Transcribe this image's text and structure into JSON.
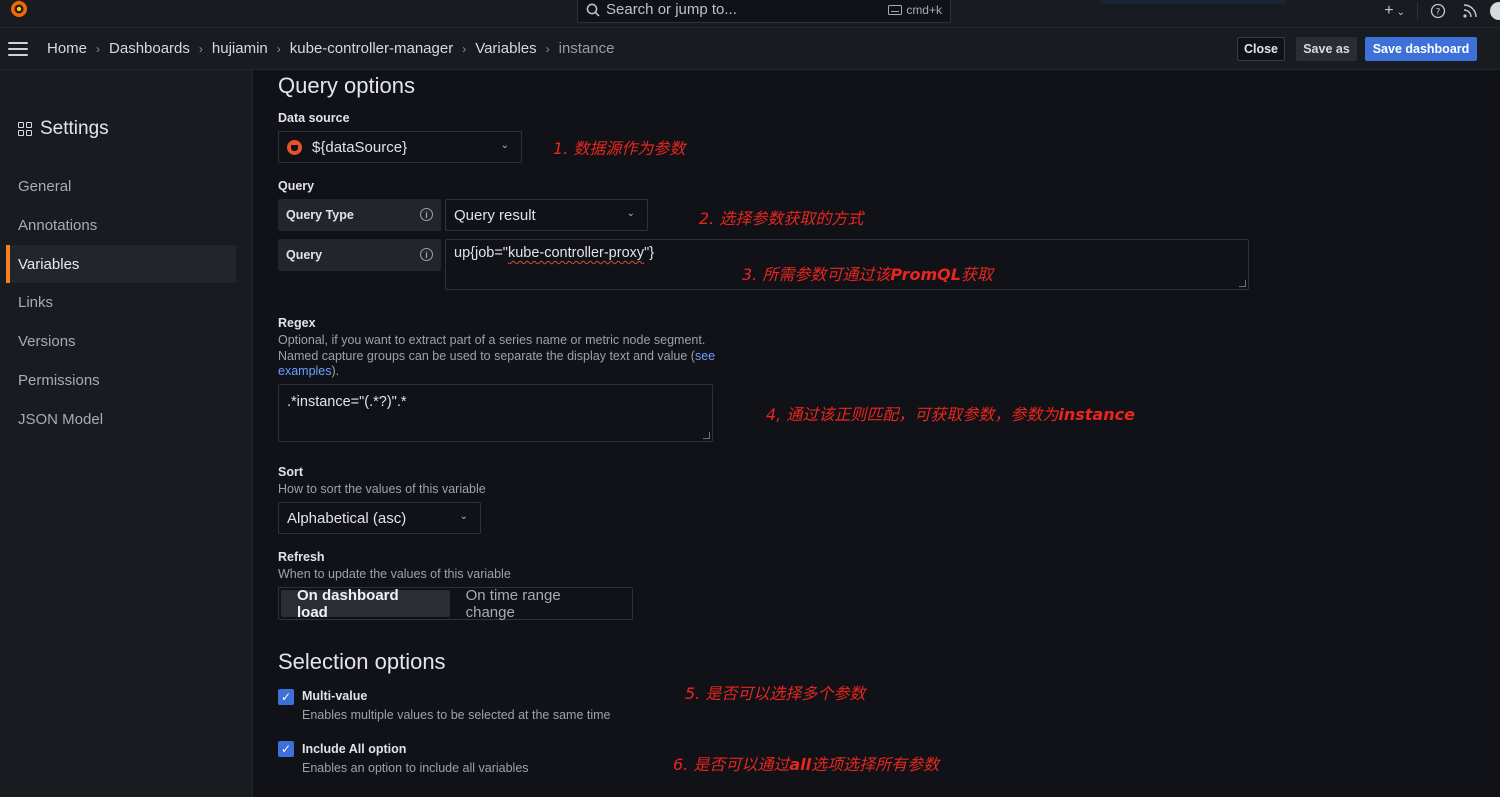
{
  "topbar": {
    "search_placeholder": "Search or jump to...",
    "shortcut": "cmd+k",
    "icons": [
      "grafana-logo-icon",
      "search-icon",
      "keyboard-icon",
      "plus-icon",
      "chevron-down-icon",
      "help-icon",
      "rss-icon",
      "avatar"
    ]
  },
  "breadcrumb": {
    "items": [
      "Home",
      "Dashboards",
      "hujiamin",
      "kube-controller-manager",
      "Variables",
      "instance"
    ]
  },
  "actions": {
    "close": "Close",
    "save_as": "Save as",
    "save_dashboard": "Save dashboard"
  },
  "sidebar": {
    "title": "Settings",
    "items": [
      "General",
      "Annotations",
      "Variables",
      "Links",
      "Versions",
      "Permissions",
      "JSON Model"
    ],
    "active": "Variables"
  },
  "query_options": {
    "heading": "Query options",
    "data_source_label": "Data source",
    "data_source_value": "${dataSource}",
    "query_label": "Query",
    "query_type_label": "Query Type",
    "query_type_value": "Query result",
    "query_field_label": "Query",
    "query_value_prefix": "up{job=\"",
    "query_value_mid": "kube-controller-proxy",
    "query_value_suffix": "\"}",
    "regex_label": "Regex",
    "regex_desc_1": "Optional, if you want to extract part of a series name or metric node segment.",
    "regex_desc_2": "Named capture groups can be used to separate the display text and value (",
    "regex_desc_link_1": "see",
    "regex_desc_link_2": "examples",
    "regex_desc_end": ").",
    "regex_value": ".*instance=\"(.*?)\".*",
    "sort_label": "Sort",
    "sort_desc": "How to sort the values of this variable",
    "sort_value": "Alphabetical (asc)",
    "refresh_label": "Refresh",
    "refresh_desc": "When to update the values of this variable",
    "refresh_options": [
      "On dashboard load",
      "On time range change"
    ],
    "refresh_selected": "On dashboard load"
  },
  "selection_options": {
    "heading": "Selection options",
    "multi_value_label": "Multi-value",
    "multi_value_desc": "Enables multiple values to be selected at the same time",
    "multi_value_checked": true,
    "include_all_label": "Include All option",
    "include_all_desc": "Enables an option to include all variables",
    "include_all_checked": true
  },
  "annotations": {
    "a1": "1. 数据源作为参数",
    "a2": "2. 选择参数获取的方式",
    "a3_pre": "3. 所需参数可通过该",
    "a3_bold": "PromQL",
    "a3_post": "获取",
    "a4_pre": "4,    通过该正则匹配，可获取参数，参数为",
    "a4_bold": "instance",
    "a5": "5. 是否可以选择多个参数",
    "a6_pre": "6. 是否可以通过",
    "a6_bold": "all",
    "a6_post": "选项选择所有参数"
  },
  "colors": {
    "accent_blue": "#3d71d9",
    "active_orange": "#f58024",
    "annotation_red": "#e8261e",
    "background": "#111217"
  }
}
